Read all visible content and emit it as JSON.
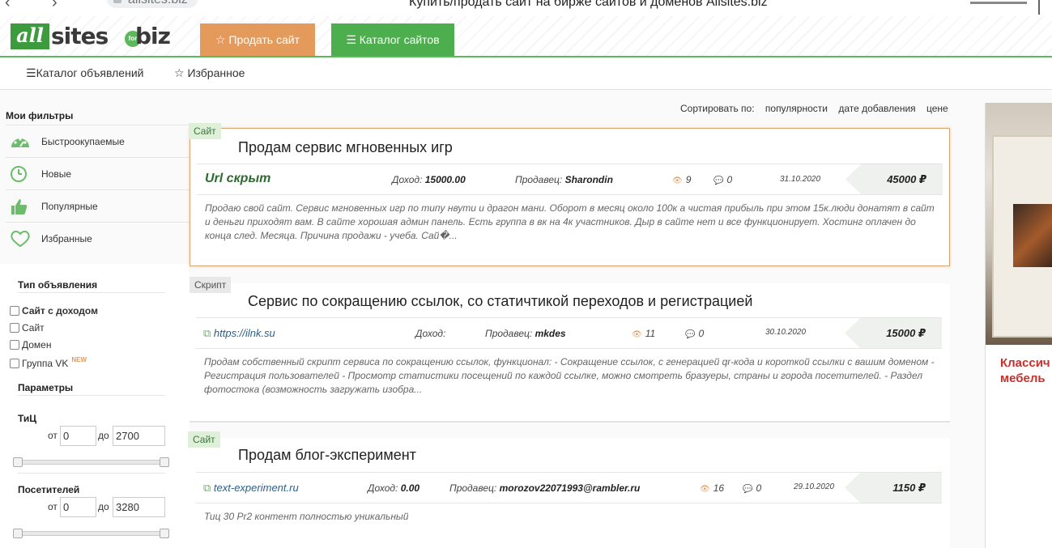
{
  "browser": {
    "url": "allsites.biz",
    "window_title": "Купить/продать сайт на бирже сайтов и доменов Allsites.biz"
  },
  "header": {
    "logo": {
      "all": "all",
      "sites": "sites",
      "for": "for",
      "biz": "biz"
    },
    "sell_button": "Продать сайт",
    "catalog_button": "Каталог сайтов",
    "colors": {
      "sell": "#e39a5a",
      "catalog": "#4cae4c"
    }
  },
  "subnav": {
    "ads_catalog": "Каталог объявлений",
    "favorites": "Избранное"
  },
  "sidebar": {
    "my_filters_title": "Мои фильтры",
    "filters": [
      {
        "label": "Быстроокупаемые",
        "icon": "speedometer-icon"
      },
      {
        "label": "Новые",
        "icon": "clock-icon"
      },
      {
        "label": "Популярные",
        "icon": "thumbs-up-icon"
      },
      {
        "label": "Избранные",
        "icon": "heart-icon"
      }
    ],
    "type_title": "Тип объявления",
    "types": [
      {
        "label": "Сайт с доходом",
        "bold": true
      },
      {
        "label": "Сайт"
      },
      {
        "label": "Домен"
      },
      {
        "label": "Группа VK",
        "badge": "NEW"
      }
    ],
    "params_title": "Параметры",
    "tic": {
      "label": "ТиЦ",
      "from_label": "от",
      "to_label": "до",
      "from": "0",
      "to": "2700"
    },
    "visitors": {
      "label": "Посетителей",
      "from_label": "от",
      "to_label": "до",
      "from": "0",
      "to": "3280"
    }
  },
  "sort": {
    "label": "Сортировать по:",
    "options": [
      "популярности",
      "дате добавления",
      "цене"
    ]
  },
  "listings": [
    {
      "badge": "Сайт",
      "title": "Продам сервис мгновенных игр",
      "url": "Url скрыт",
      "income_label": "Доход:",
      "income": "15000.00",
      "seller_label": "Продавец:",
      "seller": "Sharondin",
      "views": "9",
      "comments": "0",
      "date": "31.10.2020",
      "price": "45000 ₽",
      "description": "Продаю свой сайт. Сервис мгновенных игр по типу нвути и драгон мани. Оборот в месяц около 100к а чистая прибыль при этом 15к.люди донатят в сайт и деньги приходят вам. В сайте хорошая админ панель. Есть группа в вк на 4к участников. Дыр в сайте нет и все функционирует. Хостинг оплачен до конца след. Месяца. Причина продажи - учеба. Сай�..."
    },
    {
      "badge": "Скрипт",
      "title": "Сервис по сокращению ссылок, со статичтикой переходов и регистрацией",
      "url": "https://ilnk.su",
      "income_label": "Доход:",
      "income": "",
      "seller_label": "Продавец:",
      "seller": "mkdes",
      "views": "11",
      "comments": "0",
      "date": "30.10.2020",
      "price": "15000 ₽",
      "description": "Продам собственный скрипт сервиса по сокращению ссылок, функционал: - Сокращение ссылок, с генерацией qr-кода и короткой ссылки с вашим доменом - Регистрация пользователей - Просмотр статистики посещений по каждой ссылке, можно смотреть бразуеры, страны и города посетителей. - Раздел фотостока (возможность загружать изобра..."
    },
    {
      "badge": "Сайт",
      "title": "Продам блог-эксперимент",
      "url": "text-experiment.ru",
      "income_label": "Доход:",
      "income": "0.00",
      "seller_label": "Продавец:",
      "seller": "morozov22071993@rambler.ru",
      "views": "16",
      "comments": "0",
      "date": "29.10.2020",
      "price": "1150 ₽",
      "description": "Тиц 30 Pr2 контент полностью уникальный"
    }
  ],
  "ad": {
    "line1": "Классич",
    "line2": "мебель"
  }
}
